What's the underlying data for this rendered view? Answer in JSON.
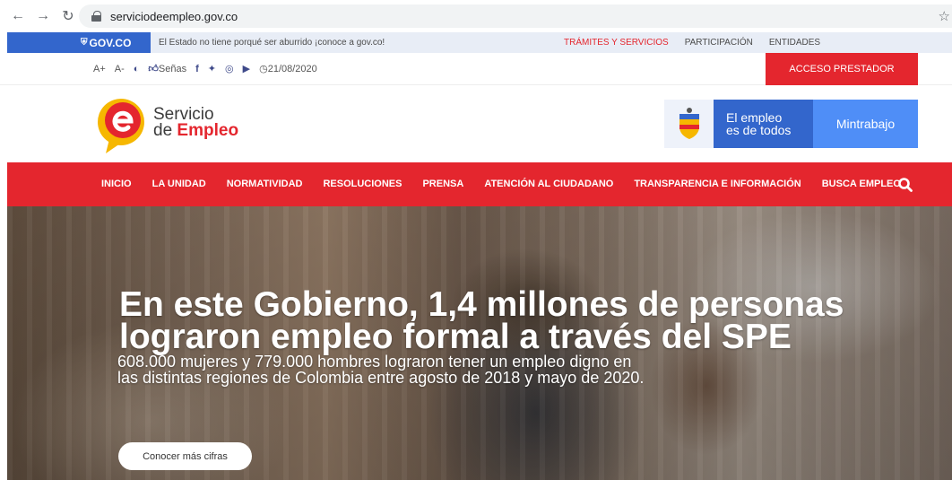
{
  "browser": {
    "url": "serviciodeempleo.gov.co",
    "back_icon": "back-arrow-icon",
    "forward_icon": "forward-arrow-icon",
    "reload_icon": "reload-icon",
    "bookmark_icon": "star-icon"
  },
  "govbar": {
    "logo": "GOV.CO",
    "message": "El Estado no tiene porqué ser aburrido ¡conoce a gov.co!",
    "links": [
      "TRÁMITES Y SERVICIOS",
      "PARTICIPACIÓN",
      "ENTIDADES"
    ],
    "active_link_color": "#e4262e"
  },
  "tools": {
    "font_increase": "A+",
    "font_decrease": "A-",
    "contrast_icon": "contrast-icon",
    "signs_label": "Señas",
    "social_icons": [
      "facebook-icon",
      "twitter-icon",
      "instagram-icon",
      "youtube-icon"
    ],
    "date": "21/08/2020",
    "acceso_label": "ACCESO PRESTADOR"
  },
  "header": {
    "brand_line1": "Servicio",
    "brand_line2_prefix": "de",
    "brand_line2_highlight": "Empleo",
    "mint_slogan_line1": "El empleo",
    "mint_slogan_line2": "es de todos",
    "mint_name": "Mintrabajo"
  },
  "nav": {
    "items": [
      "INICIO",
      "LA UNIDAD",
      "NORMATIVIDAD",
      "RESOLUCIONES",
      "PRENSA",
      "ATENCIÓN AL CIUDADANO",
      "TRANSPARENCIA E INFORMACIÓN",
      "BUSCA EMPLEO"
    ],
    "search_icon": "search-icon"
  },
  "hero": {
    "title": "En este Gobierno, 1,4 millones de personas lograron empleo formal a través del SPE",
    "subtitle": "608.000 mujeres y 779.000 hombres lograron tener un empleo digno en las distintas regiones de Colombia entre agosto de 2018 y mayo de 2020.",
    "cta_label": "Conocer más cifras"
  },
  "colors": {
    "brand_red": "#e4262e",
    "gov_blue": "#3366cc",
    "mint_light_blue": "#4f8ef7"
  }
}
